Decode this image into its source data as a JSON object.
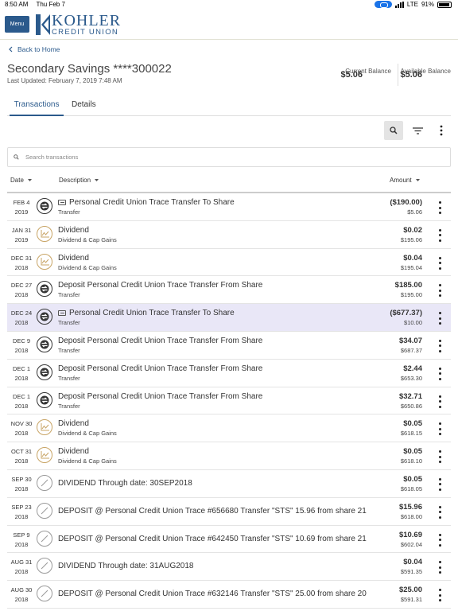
{
  "status": {
    "time": "8:50 AM",
    "day": "Thu Feb 7",
    "network": "LTE",
    "battery": "91%"
  },
  "header": {
    "menu_label": "Menu",
    "brand_line1": "KOHLER",
    "brand_line2": "CREDIT UNION"
  },
  "nav": {
    "back_label": "Back to Home"
  },
  "account": {
    "title": "Secondary Savings ****300022",
    "updated": "Last Updated: February 7, 2019 7:48 AM",
    "current_balance": "$5.06",
    "current_label": "Current Balance",
    "available_balance": "$5.06",
    "available_label": "Available Balance"
  },
  "tabs": [
    {
      "label": "Transactions",
      "active": true
    },
    {
      "label": "Details",
      "active": false
    }
  ],
  "search": {
    "placeholder": "Search transactions"
  },
  "columns": {
    "date": "Date",
    "description": "Description",
    "amount": "Amount"
  },
  "colors": {
    "brand": "#2b5a8c",
    "highlight": "#e9e7f7",
    "dividend_icon": "#c8a465"
  },
  "transactions": [
    {
      "md": "FEB 4",
      "yr": "2019",
      "icon": "transfer-icon",
      "memo": true,
      "desc": "Personal Credit Union Trace Transfer To Share",
      "cat": "Transfer",
      "amount": "($190.00)",
      "balance": "$5.06"
    },
    {
      "md": "JAN 31",
      "yr": "2019",
      "icon": "dividend-icon",
      "memo": false,
      "desc": "Dividend",
      "cat": "Dividend & Cap Gains",
      "amount": "$0.02",
      "balance": "$195.06"
    },
    {
      "md": "DEC 31",
      "yr": "2018",
      "icon": "dividend-icon",
      "memo": false,
      "desc": "Dividend",
      "cat": "Dividend & Cap Gains",
      "amount": "$0.04",
      "balance": "$195.04"
    },
    {
      "md": "DEC 27",
      "yr": "2018",
      "icon": "transfer-icon",
      "memo": false,
      "desc": "Deposit Personal Credit Union Trace Transfer From Share",
      "cat": "Transfer",
      "amount": "$185.00",
      "balance": "$195.00"
    },
    {
      "md": "DEC 24",
      "yr": "2018",
      "icon": "transfer-icon",
      "memo": true,
      "desc": "Personal Credit Union Trace Transfer To Share",
      "cat": "Transfer",
      "amount": "($677.37)",
      "balance": "$10.00",
      "highlight": true
    },
    {
      "md": "DEC 9",
      "yr": "2018",
      "icon": "transfer-icon",
      "memo": false,
      "desc": "Deposit Personal Credit Union Trace Transfer From Share",
      "cat": "Transfer",
      "amount": "$34.07",
      "balance": "$687.37"
    },
    {
      "md": "DEC 1",
      "yr": "2018",
      "icon": "transfer-icon",
      "memo": false,
      "desc": "Deposit Personal Credit Union Trace Transfer From Share",
      "cat": "Transfer",
      "amount": "$2.44",
      "balance": "$653.30"
    },
    {
      "md": "DEC 1",
      "yr": "2018",
      "icon": "transfer-icon",
      "memo": false,
      "desc": "Deposit Personal Credit Union Trace Transfer From Share",
      "cat": "Transfer",
      "amount": "$32.71",
      "balance": "$650.86"
    },
    {
      "md": "NOV 30",
      "yr": "2018",
      "icon": "dividend-icon",
      "memo": false,
      "desc": "Dividend",
      "cat": "Dividend & Cap Gains",
      "amount": "$0.05",
      "balance": "$618.15"
    },
    {
      "md": "OCT 31",
      "yr": "2018",
      "icon": "dividend-icon",
      "memo": false,
      "desc": "Dividend",
      "cat": "Dividend & Cap Gains",
      "amount": "$0.05",
      "balance": "$618.10"
    },
    {
      "md": "SEP 30",
      "yr": "2018",
      "icon": "uncategorized-icon",
      "memo": false,
      "desc": "DIVIDEND Through date: 30SEP2018",
      "cat": "",
      "amount": "$0.05",
      "balance": "$618.05"
    },
    {
      "md": "SEP 23",
      "yr": "2018",
      "icon": "uncategorized-icon",
      "memo": false,
      "desc": "DEPOSIT @ Personal Credit Union Trace #656680 Transfer \"STS\" 15.96 from share 21",
      "cat": "",
      "amount": "$15.96",
      "balance": "$618.00"
    },
    {
      "md": "SEP 9",
      "yr": "2018",
      "icon": "uncategorized-icon",
      "memo": false,
      "desc": "DEPOSIT @ Personal Credit Union Trace #642450 Transfer \"STS\" 10.69 from share 21",
      "cat": "",
      "amount": "$10.69",
      "balance": "$602.04"
    },
    {
      "md": "AUG 31",
      "yr": "2018",
      "icon": "uncategorized-icon",
      "memo": false,
      "desc": "DIVIDEND Through date: 31AUG2018",
      "cat": "",
      "amount": "$0.04",
      "balance": "$591.35"
    },
    {
      "md": "AUG 30",
      "yr": "2018",
      "icon": "uncategorized-icon",
      "memo": false,
      "desc": "DEPOSIT @ Personal Credit Union Trace #632146 Transfer \"STS\" 25.00 from share 20",
      "cat": "",
      "amount": "$25.00",
      "balance": "$591.31"
    }
  ]
}
